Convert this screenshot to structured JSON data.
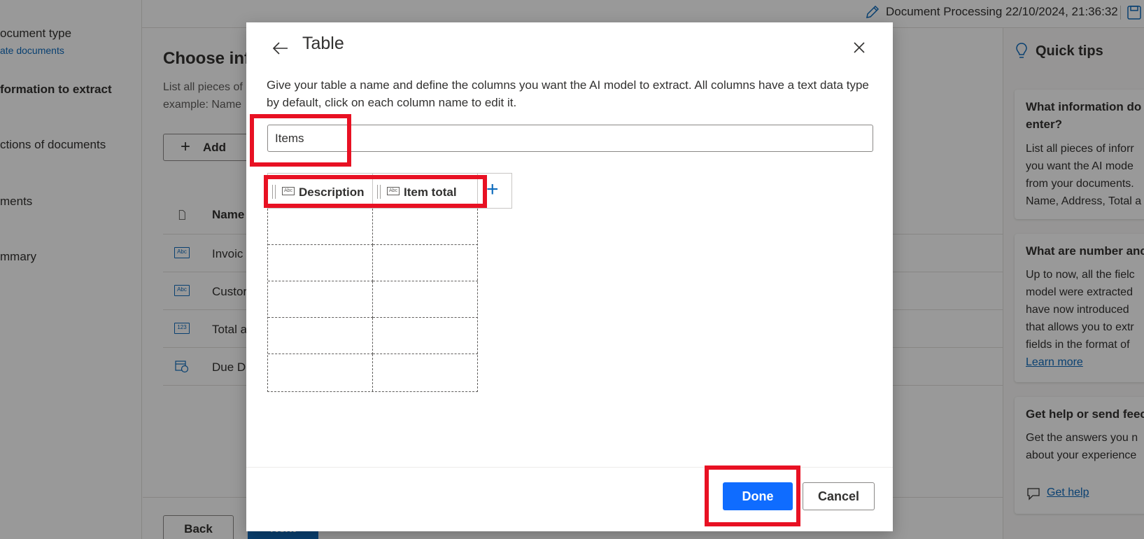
{
  "header": {
    "doc_title": "Document Processing 22/10/2024, 21:36:32"
  },
  "leftnav": {
    "items": [
      {
        "label": "ocument type"
      },
      {
        "label": "ate documents"
      },
      {
        "label": "formation to extract"
      },
      {
        "label": "ctions of documents"
      },
      {
        "label": "ments"
      },
      {
        "label": "mmary"
      }
    ]
  },
  "main": {
    "title": "Choose inf",
    "desc_line1": "List all pieces of",
    "desc_line2": "example: Name",
    "add_label": "Add",
    "list_header": "Name",
    "rows": [
      {
        "label": "Invoic"
      },
      {
        "label": "Custor"
      },
      {
        "label": "Total a"
      },
      {
        "label": "Due D"
      }
    ],
    "back_label": "Back",
    "next_label": "Next"
  },
  "quick_tips": {
    "title": "Quick tips",
    "card1": {
      "title_l1": "What information do",
      "title_l2": "enter?",
      "body": [
        "List all pieces of inforr",
        "you want the AI mode",
        "from your documents.",
        "Name, Address, Total a"
      ]
    },
    "card2": {
      "title": "What are number anc",
      "body": [
        "Up to now, all the fielc",
        "model were extracted",
        "have now introduced",
        "that allows you to extr",
        "fields in the format of"
      ],
      "link": "Learn more"
    },
    "card3": {
      "title": "Get help or send feec",
      "body": [
        "Get the answers you n",
        "about your experience"
      ],
      "link": "Get help"
    }
  },
  "dialog": {
    "title": "Table",
    "description": "Give your table a name and define the columns you want the AI model to extract. All columns have a text data type by default, click on each column name to edit it.",
    "table_name_value": "Items",
    "columns": [
      {
        "label": "Description"
      },
      {
        "label": "Item total"
      }
    ],
    "done_label": "Done",
    "cancel_label": "Cancel"
  },
  "colors": {
    "accent": "#0f6cff",
    "highlight": "#e81123",
    "link": "#0f6cbd"
  }
}
